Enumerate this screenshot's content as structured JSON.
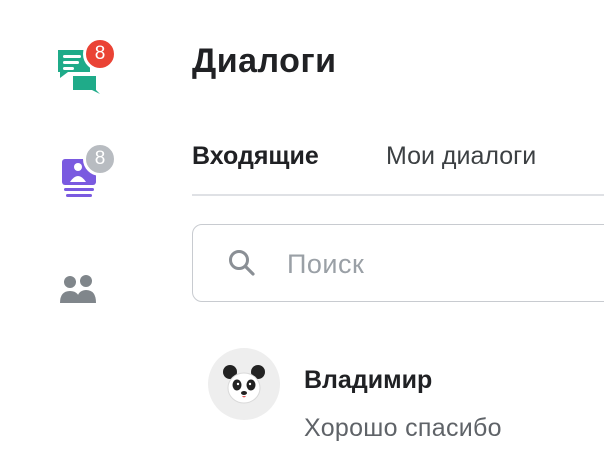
{
  "colors": {
    "dialogs_icon": "#1fab89",
    "queue_icon": "#7a5ae0",
    "contacts_icon": "#80868b",
    "badge_red": "#ea4335",
    "badge_gray": "#b8bcc1"
  },
  "rail": {
    "items": [
      {
        "icon": "chat-bubbles-icon",
        "badge": "8"
      },
      {
        "icon": "person-stack-icon",
        "badge": "8"
      },
      {
        "icon": "people-icon"
      }
    ]
  },
  "header": {
    "title": "Диалоги"
  },
  "tabs": [
    {
      "label": "Входящие",
      "active": true
    },
    {
      "label": "Мои диалоги",
      "active": false
    }
  ],
  "search": {
    "icon": "search-icon",
    "placeholder": "Поиск",
    "value": ""
  },
  "dialogs": [
    {
      "avatar": "panda-avatar",
      "name": "Владимир",
      "preview": "Хорошо спасибо"
    }
  ]
}
